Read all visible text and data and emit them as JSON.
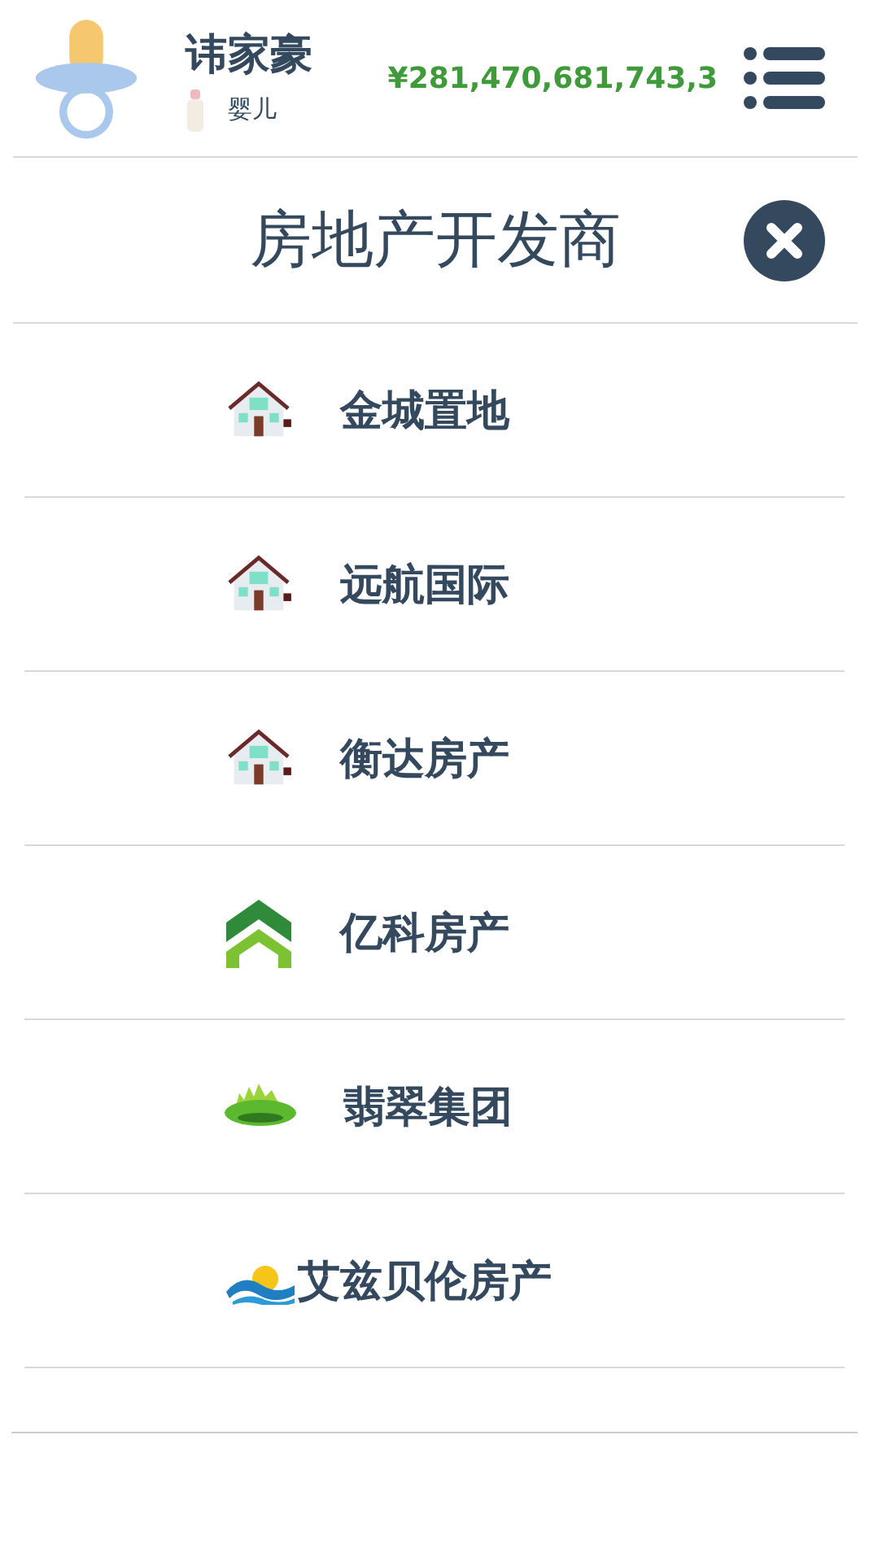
{
  "header": {
    "name": "讳家豪",
    "stage": "婴儿",
    "money": "¥281,470,681,743,3"
  },
  "panel": {
    "title": "房地产开发商"
  },
  "developers": [
    {
      "name": "金城置地",
      "kind": "house"
    },
    {
      "name": "远航国际",
      "kind": "house"
    },
    {
      "name": "衡达房产",
      "kind": "house"
    },
    {
      "name": "亿科房产",
      "kind": "chevron"
    },
    {
      "name": "翡翠集团",
      "kind": "city"
    },
    {
      "name": "艾兹贝伦房产",
      "kind": "wave"
    }
  ]
}
